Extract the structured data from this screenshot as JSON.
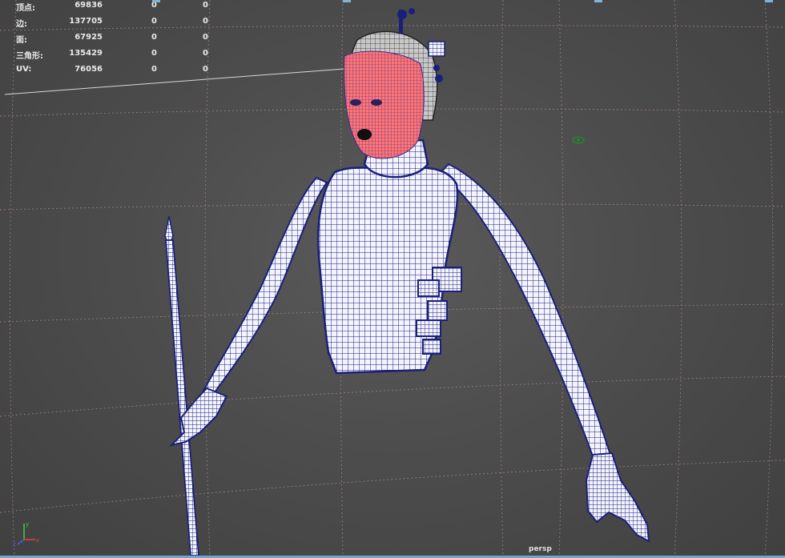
{
  "hud": {
    "rows": [
      {
        "label": "顶点:",
        "v1": "69836",
        "v2": "0",
        "v3": "0"
      },
      {
        "label": "边:",
        "v1": "137705",
        "v2": "0",
        "v3": "0"
      },
      {
        "label": "面:",
        "v1": "67925",
        "v2": "0",
        "v3": "0"
      },
      {
        "label": "三角形:",
        "v1": "135429",
        "v2": "0",
        "v3": "0"
      },
      {
        "label": "UV:",
        "v1": "76056",
        "v2": "0",
        "v3": "0"
      }
    ]
  },
  "viewport": {
    "camera": "persp",
    "axis": {
      "x": "x",
      "y": "y",
      "z": "z"
    }
  },
  "colors": {
    "background": "#4a4a4a",
    "grid": "#b88a8a",
    "wireframe": "#1a1f7a",
    "selection": "#ff6b6b",
    "hud_text": "#e8e8e8",
    "bottom_bar": "#6fa6c9"
  },
  "icons": [
    "axis-gizmo-icon",
    "camera-icon"
  ]
}
